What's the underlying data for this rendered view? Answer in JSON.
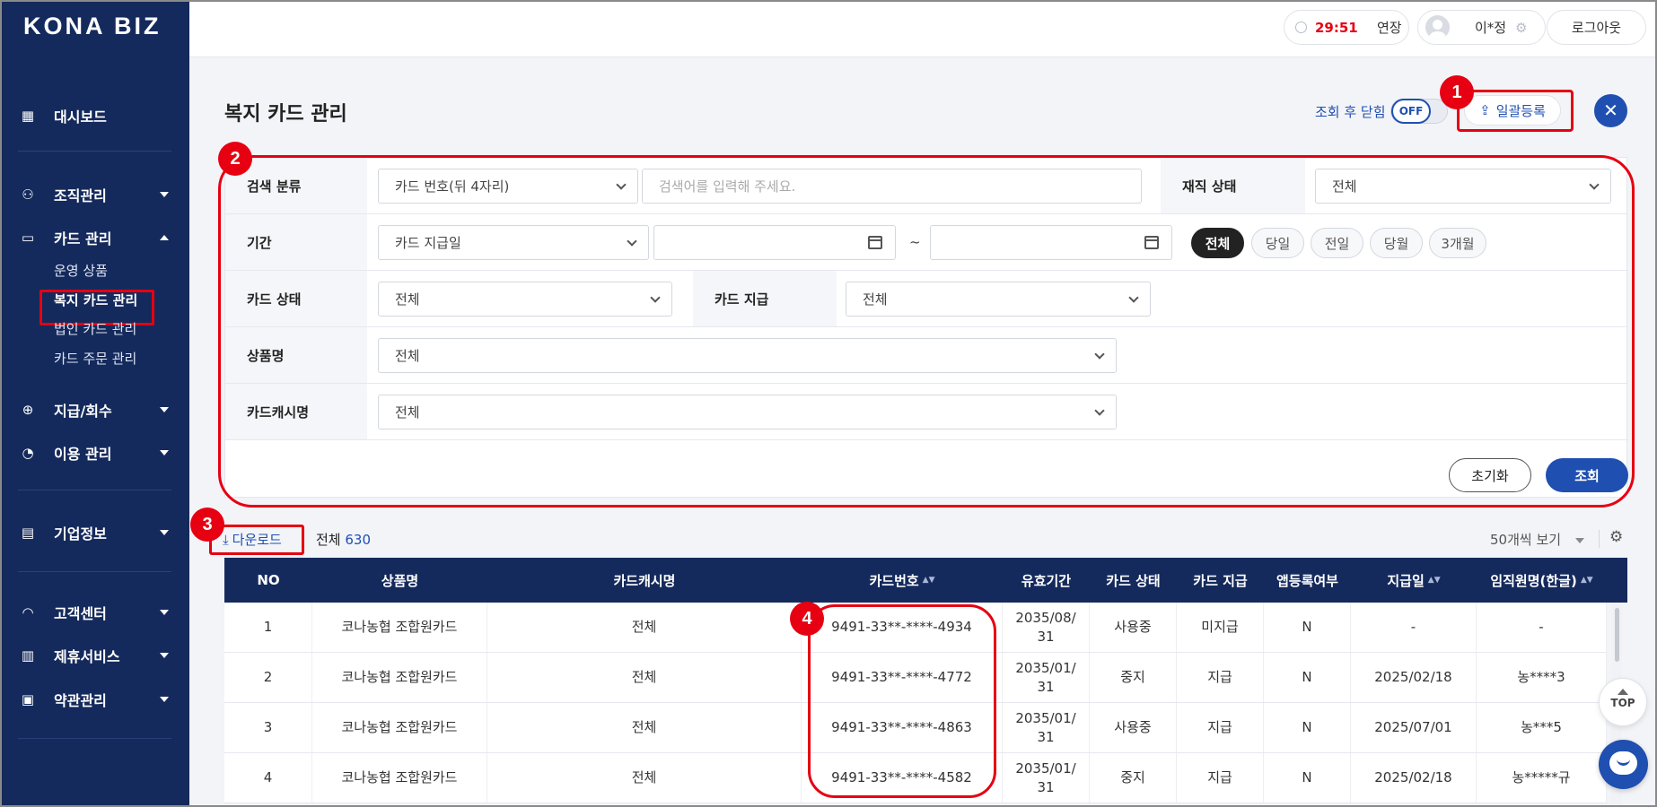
{
  "brand": {
    "logo": "KONA BIZ",
    "accent": "#1f4fb0",
    "nav_bg": "#152a5c",
    "highlight": "#e60012"
  },
  "sidebar": {
    "items": [
      {
        "label": "대시보드",
        "icon": "dashboard-icon"
      },
      {
        "label": "조직관리",
        "icon": "organization-icon"
      },
      {
        "label": "카드 관리",
        "icon": "card-icon"
      },
      {
        "label": "지급/회수",
        "icon": "payment-icon"
      },
      {
        "label": "이용 관리",
        "icon": "usage-icon"
      },
      {
        "label": "기업정보",
        "icon": "company-icon"
      },
      {
        "label": "고객센터",
        "icon": "headset-icon"
      },
      {
        "label": "제휴서비스",
        "icon": "partner-icon"
      },
      {
        "label": "약관관리",
        "icon": "terms-icon"
      }
    ],
    "card_submenu": [
      "운영 상품",
      "복지 카드 관리",
      "법인 카드 관리",
      "카드 주문 관리"
    ]
  },
  "topbar": {
    "timer": "29:51",
    "extend_label": "연장",
    "user_name": "이*정",
    "logout_label": "로그아웃"
  },
  "page": {
    "title": "복지 카드 관리",
    "toggle_label": "조회 후 닫힘",
    "toggle_state": "OFF",
    "bulk_register_label": "일괄등록",
    "close_icon": "close-icon"
  },
  "badges": [
    "1",
    "2",
    "3",
    "4"
  ],
  "search": {
    "category_label": "검색 분류",
    "category_value": "카드 번호(뒤 4자리)",
    "keyword_placeholder": "검색어를 입력해 주세요.",
    "employment_label": "재직 상태",
    "employment_value": "전체",
    "period_label": "기간",
    "period_type_value": "카드 지급일",
    "tilde": "~",
    "period_chips": [
      "전체",
      "당일",
      "전일",
      "당월",
      "3개월"
    ],
    "card_status_label": "카드 상태",
    "card_status_value": "전체",
    "card_issue_label": "카드 지급",
    "card_issue_value": "전체",
    "product_label": "상품명",
    "product_value": "전체",
    "cash_label": "카드캐시명",
    "cash_value": "전체",
    "reset_label": "초기화",
    "search_label": "조회"
  },
  "list": {
    "download_label": "다운로드",
    "total_label": "전체",
    "total_count": "630",
    "per_page_label": "50개씩 보기"
  },
  "table": {
    "columns": [
      "NO",
      "상품명",
      "카드캐시명",
      "카드번호",
      "유효기간",
      "카드 상태",
      "카드 지급",
      "앱등록여부",
      "지급일",
      "임직원명(한글)"
    ],
    "rows": [
      [
        "1",
        "코나농협 조합원카드",
        "전체",
        "9491-33**-****-4934",
        "2035/08/ 31",
        "사용중",
        "미지급",
        "N",
        "-",
        "-"
      ],
      [
        "2",
        "코나농협 조합원카드",
        "전체",
        "9491-33**-****-4772",
        "2035/01/ 31",
        "중지",
        "지급",
        "N",
        "2025/02/18",
        "농****3"
      ],
      [
        "3",
        "코나농협 조합원카드",
        "전체",
        "9491-33**-****-4863",
        "2035/01/ 31",
        "사용중",
        "지급",
        "N",
        "2025/07/01",
        "농***5"
      ],
      [
        "4",
        "코나농협 조합원카드",
        "전체",
        "9491-33**-****-4582",
        "2035/01/ 31",
        "중지",
        "지급",
        "N",
        "2025/02/18",
        "농*****규"
      ]
    ]
  },
  "floating": {
    "top_label": "TOP"
  }
}
